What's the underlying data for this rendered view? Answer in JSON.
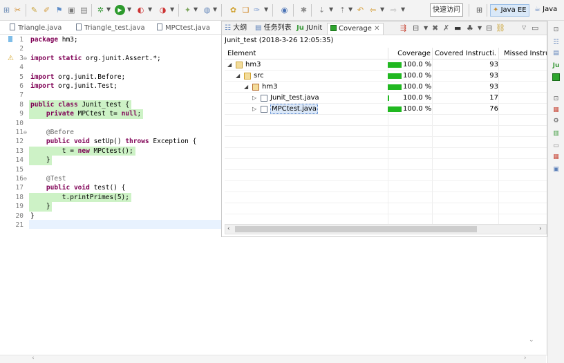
{
  "toolbar": {
    "quick_access": "快速访问",
    "perspectives": [
      "Java EE",
      "Java"
    ]
  },
  "editor": {
    "tabs": [
      "Triangle.java",
      "Triangle_test.java",
      "MPCtest.java"
    ],
    "lines": [
      {
        "n": "1",
        "text": "package hm3;",
        "hl": false
      },
      {
        "n": "2",
        "text": "",
        "hl": false
      },
      {
        "n": "3",
        "text": "import static org.junit.Assert.*;",
        "hl": false
      },
      {
        "n": "4",
        "text": "",
        "hl": false
      },
      {
        "n": "5",
        "text": "import org.junit.Before;",
        "hl": false
      },
      {
        "n": "6",
        "text": "import org.junit.Test;",
        "hl": false
      },
      {
        "n": "7",
        "text": "",
        "hl": false
      },
      {
        "n": "8",
        "text": "public class Junit_test {",
        "hl": true
      },
      {
        "n": "9",
        "text": "    private MPCtest t= null;",
        "hl": true
      },
      {
        "n": "10",
        "text": "",
        "hl": false
      },
      {
        "n": "11",
        "text": "    @Before",
        "hl": false
      },
      {
        "n": "12",
        "text": "    public void setUp() throws Exception {",
        "hl": false
      },
      {
        "n": "13",
        "text": "        t = new MPCtest();",
        "hl": true
      },
      {
        "n": "14",
        "text": "    }",
        "hl": true
      },
      {
        "n": "15",
        "text": "",
        "hl": false
      },
      {
        "n": "16",
        "text": "    @Test",
        "hl": false
      },
      {
        "n": "17",
        "text": "    public void test() {",
        "hl": false
      },
      {
        "n": "18",
        "text": "        t.printPrimes(5);",
        "hl": true
      },
      {
        "n": "19",
        "text": "    }",
        "hl": true
      },
      {
        "n": "20",
        "text": "}",
        "hl": false
      },
      {
        "n": "21",
        "text": "",
        "hl": false
      }
    ]
  },
  "coverage_view": {
    "tabs": [
      "大纲",
      "任务列表",
      "JUnit",
      "Coverage"
    ],
    "active_tab": "Coverage",
    "session": "Junit_test (2018-3-26 12:05:35)",
    "columns": [
      "Element",
      "Coverage",
      "Covered Instructi...",
      "Missed Instru"
    ],
    "rows": [
      {
        "name": "hm3",
        "coverage": "100.0 %",
        "coverage_value": 1.0,
        "covered": "93",
        "level": 0,
        "icon": "project-icon"
      },
      {
        "name": "src",
        "coverage": "100.0 %",
        "coverage_value": 1.0,
        "covered": "93",
        "level": 1,
        "icon": "source-folder-icon"
      },
      {
        "name": "hm3",
        "coverage": "100.0 %",
        "coverage_value": 1.0,
        "covered": "93",
        "level": 2,
        "icon": "package-icon"
      },
      {
        "name": "Junit_test.java",
        "coverage": "100.0 %",
        "coverage_value": 0.12,
        "covered": "17",
        "level": 3,
        "icon": "java-file-icon"
      },
      {
        "name": "MPCtest.java",
        "coverage": "100.0 %",
        "coverage_value": 1.0,
        "covered": "76",
        "level": 3,
        "icon": "java-file-icon"
      }
    ]
  }
}
